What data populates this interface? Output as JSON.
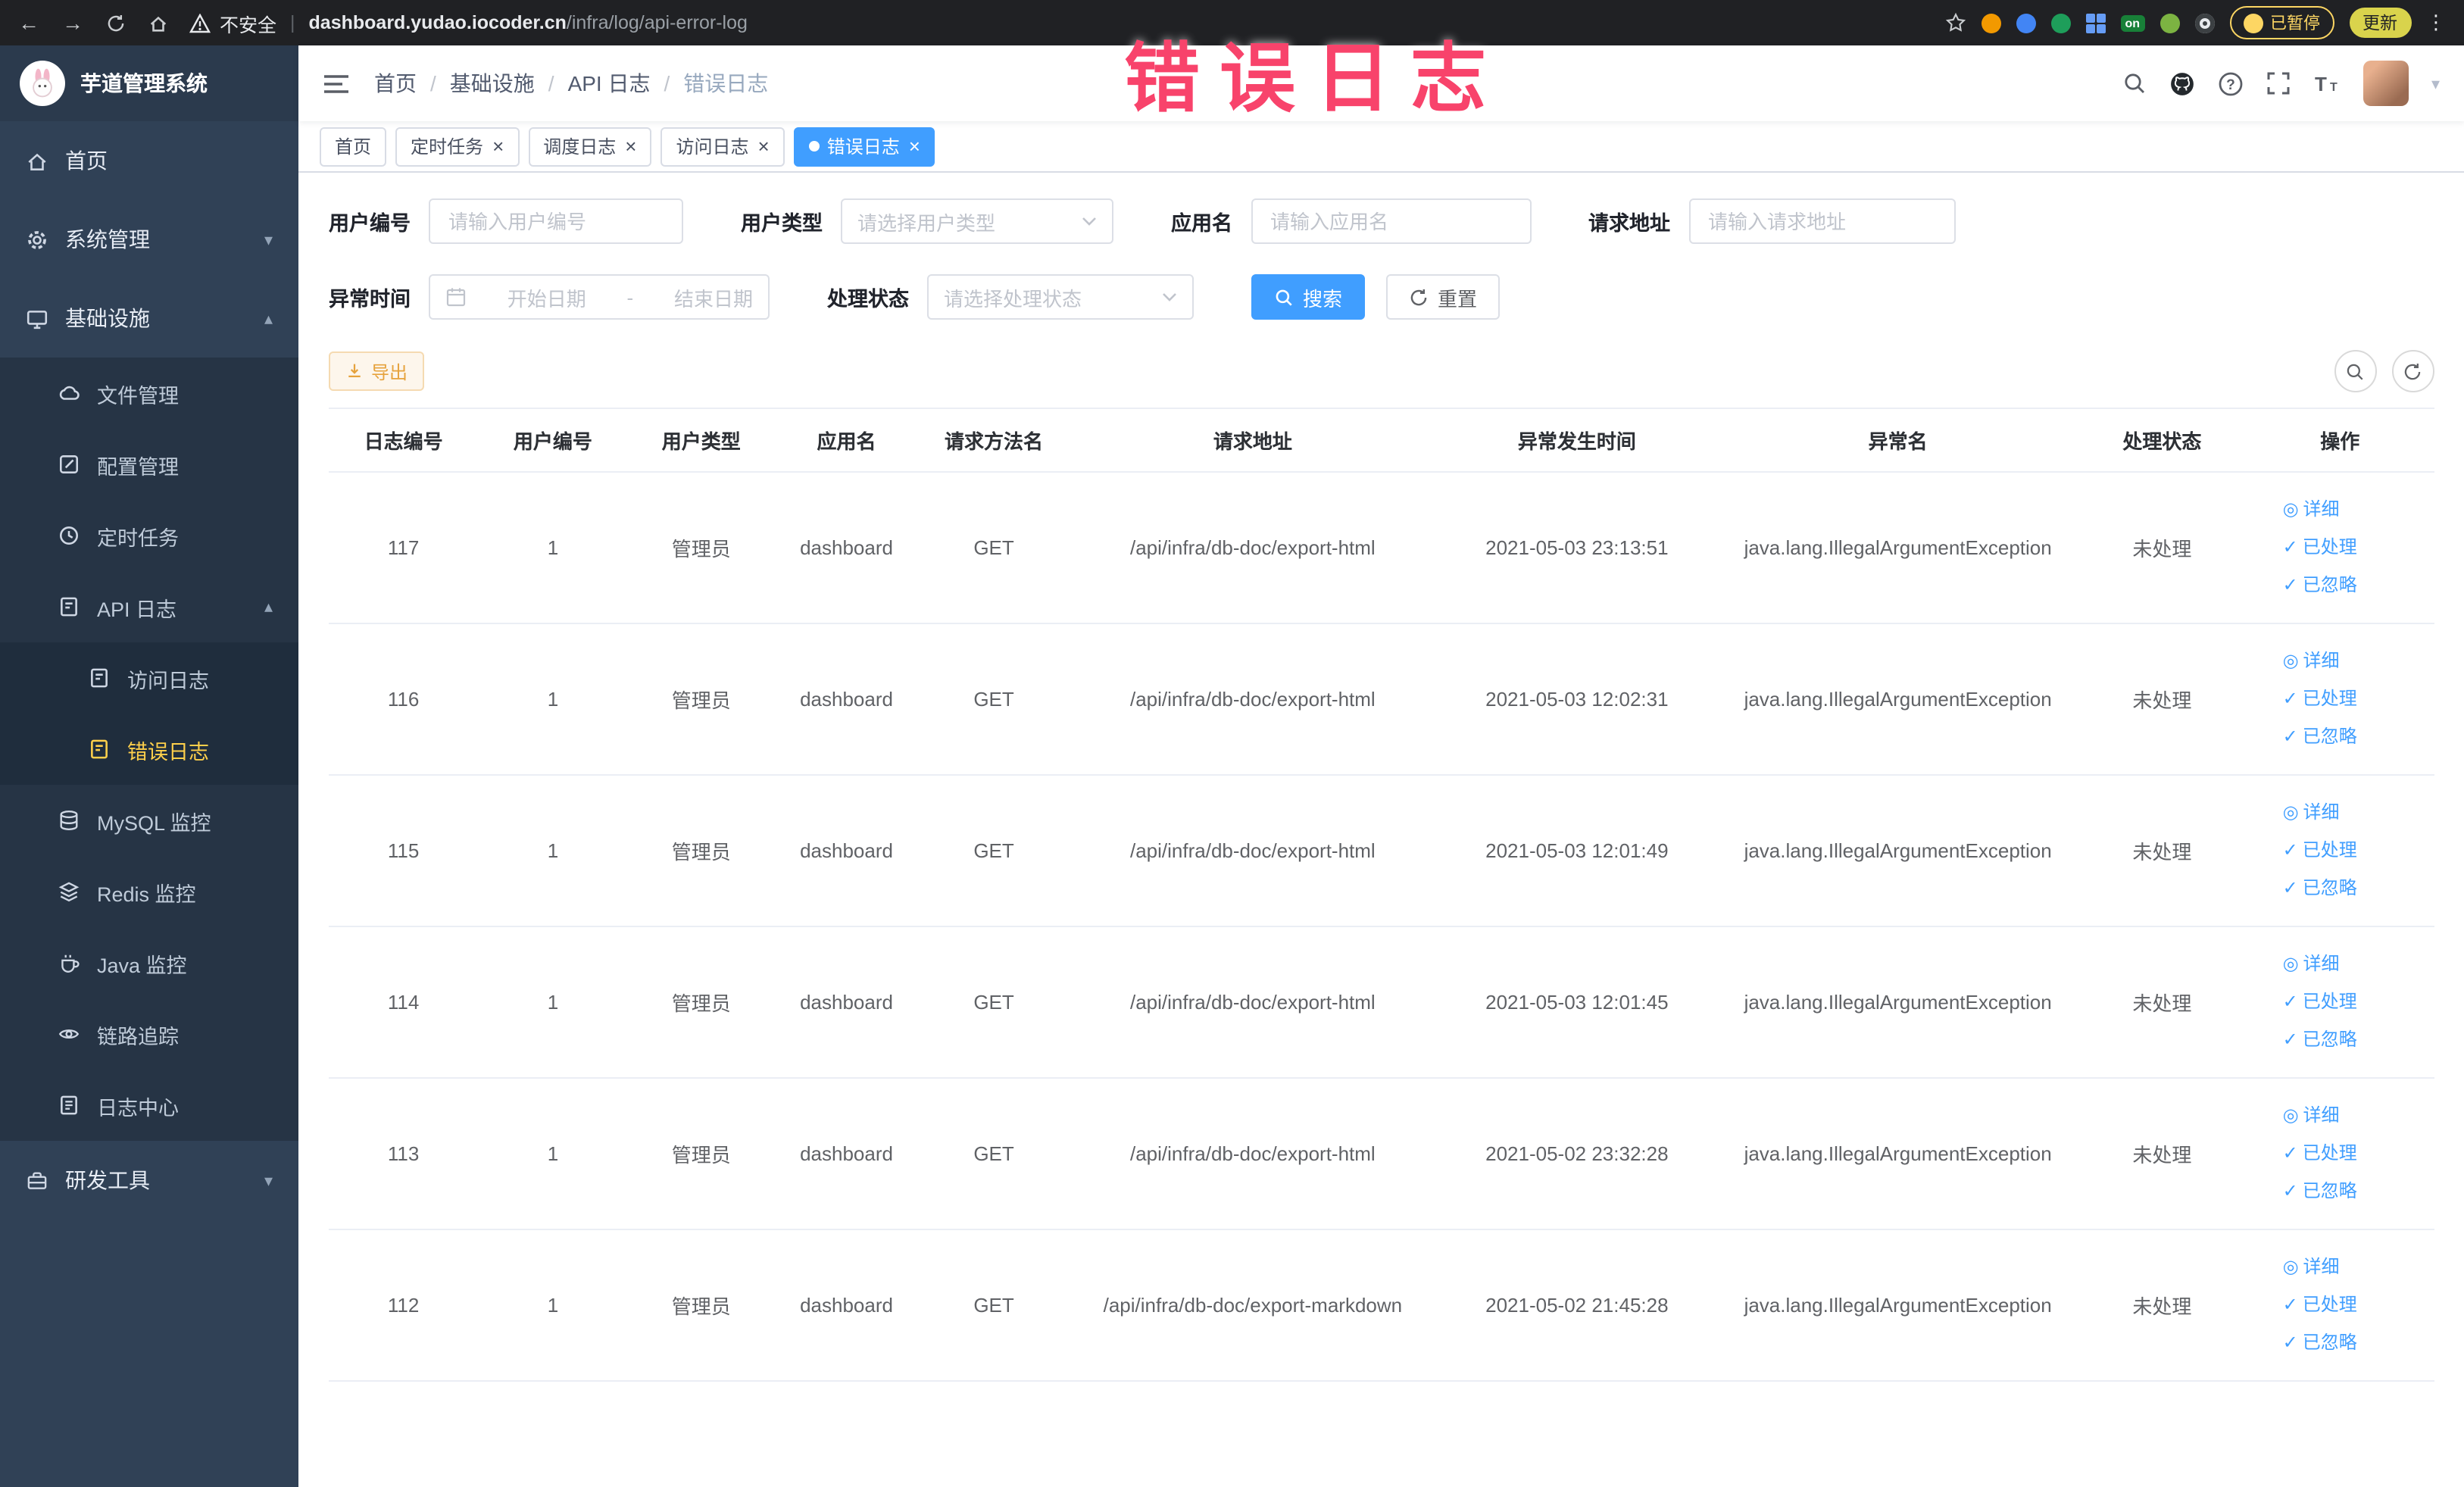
{
  "colors": {
    "accent": "#409eff",
    "sidebar_bg": "#304156",
    "sidebar_active": "#ffd04b",
    "warning": "#e6a23c",
    "annotation": "#f8436b"
  },
  "annotation": {
    "text": "错误日志"
  },
  "browser": {
    "security_warning": "不安全",
    "url_domain": "dashboard.yudao.iocoder.cn",
    "url_path": "/infra/log/api-error-log",
    "extension_badge_on": "on",
    "paused_badge": "已暂停",
    "update_button": "更新",
    "kebab": "⋮"
  },
  "sidebar": {
    "logo_title": "芋道管理系统",
    "home": "首页",
    "system_mgmt": "系统管理",
    "infrastructure": "基础设施",
    "file_mgmt": "文件管理",
    "config_mgmt": "配置管理",
    "scheduled_jobs": "定时任务",
    "api_logs": "API 日志",
    "access_log": "访问日志",
    "error_log": "错误日志",
    "mysql_monitor": "MySQL 监控",
    "redis_monitor": "Redis 监控",
    "java_monitor": "Java 监控",
    "trace": "链路追踪",
    "log_center": "日志中心",
    "dev_tools": "研发工具"
  },
  "breadcrumb": [
    "首页",
    "基础设施",
    "API 日志",
    "错误日志"
  ],
  "tabs": [
    {
      "label": "首页"
    },
    {
      "label": "定时任务"
    },
    {
      "label": "调度日志"
    },
    {
      "label": "访问日志"
    },
    {
      "label": "错误日志"
    }
  ],
  "filters": {
    "user_id_label": "用户编号",
    "user_id_placeholder": "请输入用户编号",
    "user_type_label": "用户类型",
    "user_type_placeholder": "请选择用户类型",
    "app_name_label": "应用名",
    "app_name_placeholder": "请输入应用名",
    "request_url_label": "请求地址",
    "request_url_placeholder": "请输入请求地址",
    "time_label": "异常时间",
    "time_start_placeholder": "开始日期",
    "time_separator": "-",
    "time_end_placeholder": "结束日期",
    "status_label": "处理状态",
    "status_placeholder": "请选择处理状态",
    "search_button": "搜索",
    "reset_button": "重置"
  },
  "toolbar": {
    "export_button": "导出"
  },
  "table": {
    "columns": [
      "日志编号",
      "用户编号",
      "用户类型",
      "应用名",
      "请求方法名",
      "请求地址",
      "异常发生时间",
      "异常名",
      "处理状态",
      "操作"
    ],
    "column_keys": [
      "log_id",
      "user_id",
      "user_type",
      "app_name",
      "method",
      "url",
      "time",
      "exception",
      "status"
    ],
    "actions": [
      "详细",
      "已处理",
      "已忽略"
    ],
    "rows": [
      {
        "log_id": "117",
        "user_id": "1",
        "user_type": "管理员",
        "app_name": "dashboard",
        "method": "GET",
        "url": "/api/infra/db-doc/export-html",
        "time": "2021-05-03 23:13:51",
        "exception": "java.lang.IllegalArgumentException",
        "status": "未处理"
      },
      {
        "log_id": "116",
        "user_id": "1",
        "user_type": "管理员",
        "app_name": "dashboard",
        "method": "GET",
        "url": "/api/infra/db-doc/export-html",
        "time": "2021-05-03 12:02:31",
        "exception": "java.lang.IllegalArgumentException",
        "status": "未处理"
      },
      {
        "log_id": "115",
        "user_id": "1",
        "user_type": "管理员",
        "app_name": "dashboard",
        "method": "GET",
        "url": "/api/infra/db-doc/export-html",
        "time": "2021-05-03 12:01:49",
        "exception": "java.lang.IllegalArgumentException",
        "status": "未处理"
      },
      {
        "log_id": "114",
        "user_id": "1",
        "user_type": "管理员",
        "app_name": "dashboard",
        "method": "GET",
        "url": "/api/infra/db-doc/export-html",
        "time": "2021-05-03 12:01:45",
        "exception": "java.lang.IllegalArgumentException",
        "status": "未处理"
      },
      {
        "log_id": "113",
        "user_id": "1",
        "user_type": "管理员",
        "app_name": "dashboard",
        "method": "GET",
        "url": "/api/infra/db-doc/export-html",
        "time": "2021-05-02 23:32:28",
        "exception": "java.lang.IllegalArgumentException",
        "status": "未处理"
      },
      {
        "log_id": "112",
        "user_id": "1",
        "user_type": "管理员",
        "app_name": "dashboard",
        "method": "GET",
        "url": "/api/infra/db-doc/export-markdown",
        "time": "2021-05-02 21:45:28",
        "exception": "java.lang.IllegalArgumentException",
        "status": "未处理"
      }
    ]
  }
}
